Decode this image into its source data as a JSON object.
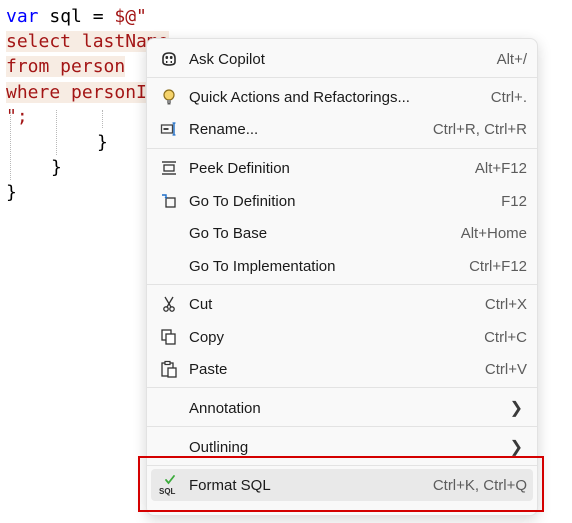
{
  "code": {
    "line1": {
      "keyword": "var",
      "ident": " sql = ",
      "literal": "$@\""
    },
    "line2": "select lastName",
    "line3": "from person",
    "line4": "where personId",
    "line5": "\";",
    "line6": "}",
    "line7": "}",
    "line8": "}"
  },
  "menu": {
    "items": [
      {
        "label": "Ask Copilot",
        "shortcut": "Alt+/",
        "icon": "copilot-icon"
      },
      {
        "label": "Quick Actions and Refactorings...",
        "shortcut": "Ctrl+.",
        "icon": "lightbulb-icon"
      },
      {
        "label": "Rename...",
        "shortcut": "Ctrl+R, Ctrl+R",
        "icon": "rename-icon"
      },
      {
        "label": "Peek Definition",
        "shortcut": "Alt+F12",
        "icon": "peek-definition-icon"
      },
      {
        "label": "Go To Definition",
        "shortcut": "F12",
        "icon": "go-to-definition-icon"
      },
      {
        "label": "Go To Base",
        "shortcut": "Alt+Home"
      },
      {
        "label": "Go To Implementation",
        "shortcut": "Ctrl+F12"
      },
      {
        "label": "Cut",
        "shortcut": "Ctrl+X",
        "icon": "scissors-icon"
      },
      {
        "label": "Copy",
        "shortcut": "Ctrl+C",
        "icon": "copy-icon"
      },
      {
        "label": "Paste",
        "shortcut": "Ctrl+V",
        "icon": "paste-icon"
      },
      {
        "label": "Annotation",
        "submenu": true
      },
      {
        "label": "Outlining",
        "submenu": true
      },
      {
        "label": "Format SQL",
        "shortcut": "Ctrl+K, Ctrl+Q",
        "icon": "format-sql-icon",
        "icon_text": "SQL",
        "highlighted": true
      }
    ]
  },
  "colors": {
    "keyword": "#0000ff",
    "string": "#a31515",
    "highlight_box": "#d40000",
    "accent_green": "#3cab3c"
  }
}
